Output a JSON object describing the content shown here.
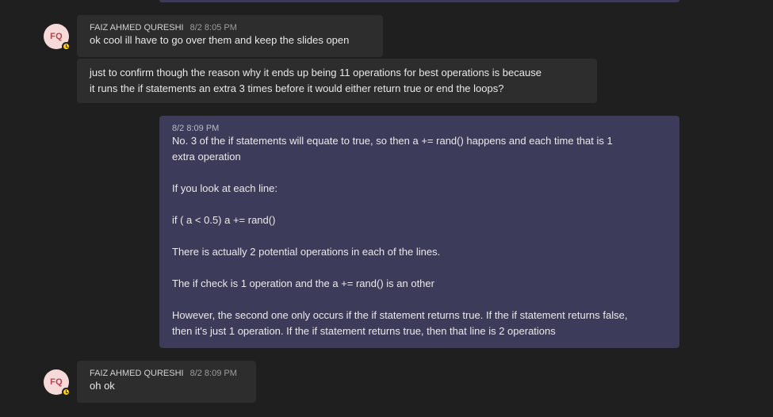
{
  "messages": [
    {
      "author": "FAIZ AHMED QURESHI",
      "initials": "FQ",
      "time": "8/2 8:05 PM",
      "text": "ok cool ill have to go over them and keep the slides open"
    },
    {
      "text_lines": [
        "just to confirm though the reason why it ends up being 11 operations for best operations is because",
        "it runs the if statements an extra 3 times before it would either return true or end the loops?"
      ]
    },
    {
      "time": "8/2 8:09 PM",
      "paragraphs": [
        [
          "No. 3 of the if statements will equate to true, so then a += rand() happens and each time that is 1",
          "extra operation"
        ],
        [
          "If you look at each line:"
        ],
        [
          "if ( a < 0.5) a += rand()"
        ],
        [
          "There is actually 2 potential operations in each of the lines."
        ],
        [
          "The if check is 1 operation and the a += rand() is an other"
        ],
        [
          "However, the second one only occurs if the if statement returns true. If the if statement returns false,",
          "then it's just 1 operation. If the if statement returns true, then that line is 2 operations"
        ]
      ]
    },
    {
      "author": "FAIZ AHMED QURESHI",
      "initials": "FQ",
      "time": "8/2 8:09 PM",
      "text": "oh ok"
    }
  ],
  "colors": {
    "background": "#1f1f1f",
    "other_bubble": "#2d2d2d",
    "self_bubble": "#3c3c5a",
    "avatar_bg": "#f6d9d9",
    "avatar_text": "#b2444c",
    "presence_away": "#f8d22a"
  },
  "icons": {
    "presence": "away-clock-icon"
  }
}
